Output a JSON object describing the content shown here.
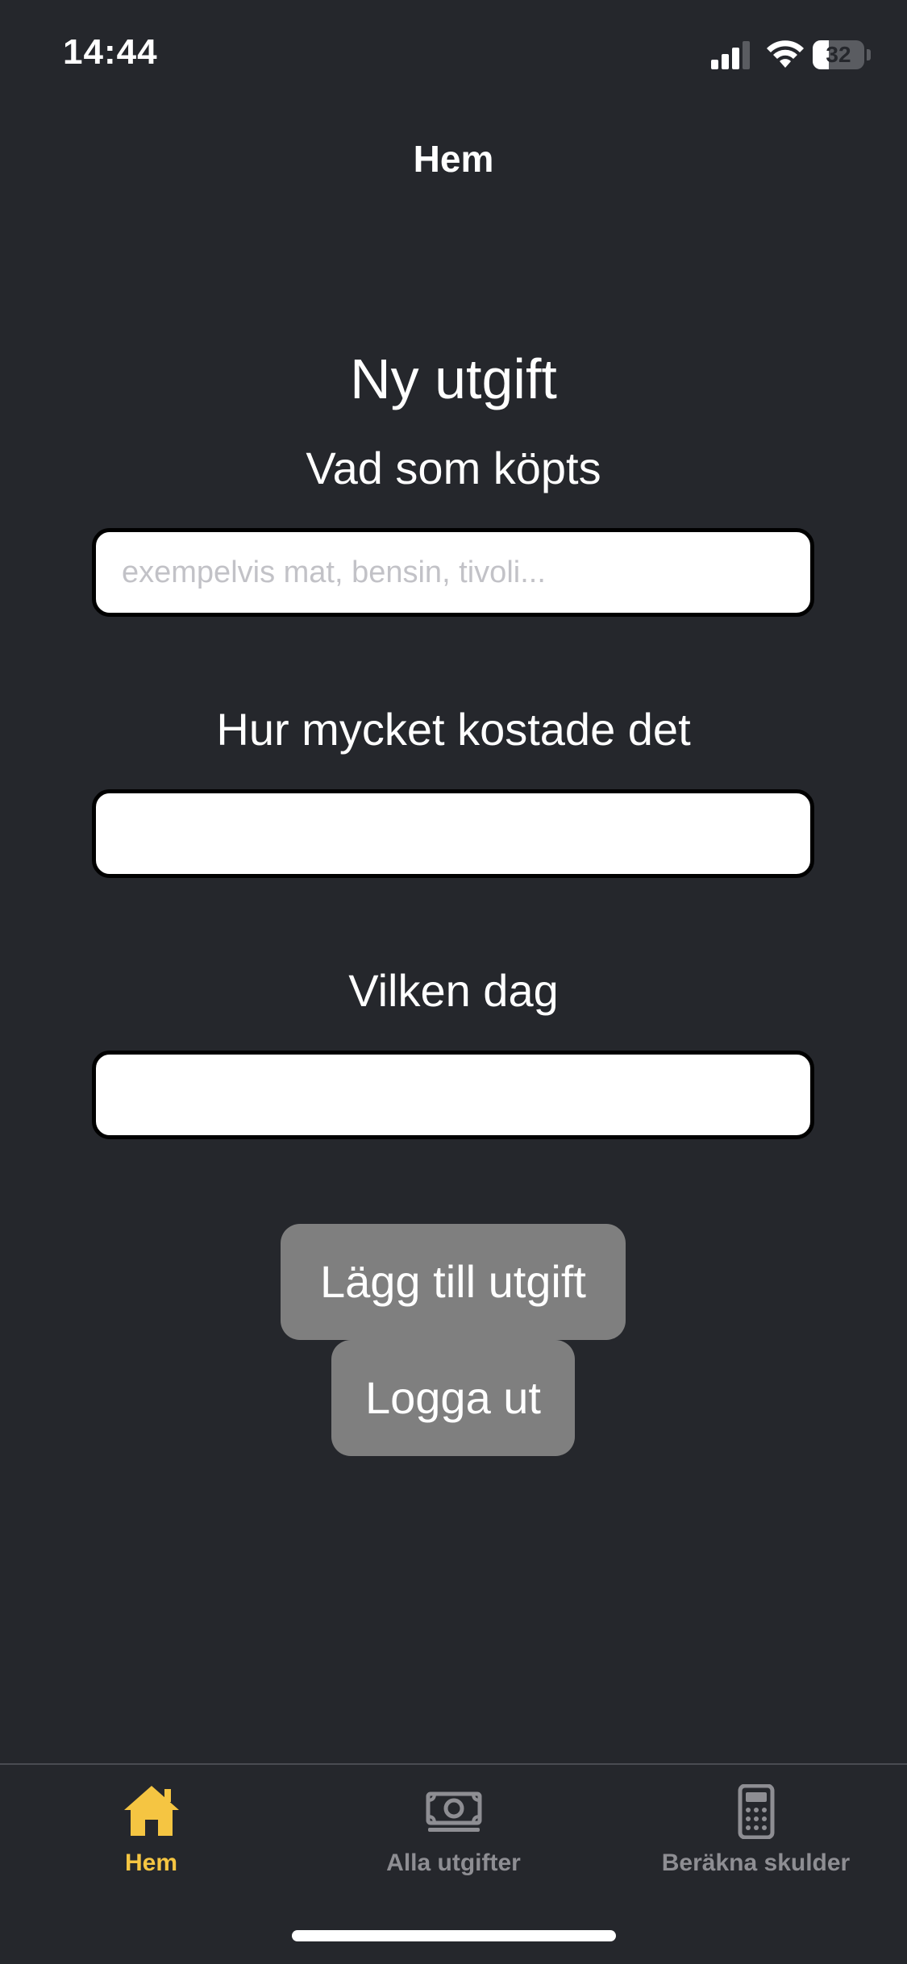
{
  "status_bar": {
    "time": "14:44",
    "battery_level": "32"
  },
  "nav": {
    "title": "Hem"
  },
  "form": {
    "heading": "Ny utgift",
    "what_label": "Vad som köpts",
    "what_placeholder": "exempelvis mat, bensin, tivoli...",
    "what_value": "",
    "cost_label": "Hur mycket kostade det",
    "cost_value": "",
    "day_label": "Vilken dag",
    "day_value": "",
    "add_button": "Lägg till utgift",
    "logout_button": "Logga ut"
  },
  "tabbar": {
    "tabs": [
      {
        "label": "Hem",
        "icon": "home-icon",
        "active": true
      },
      {
        "label": "Alla utgifter",
        "icon": "money-icon",
        "active": false
      },
      {
        "label": "Beräkna skulder",
        "icon": "calculator-icon",
        "active": false
      }
    ]
  },
  "colors": {
    "background": "#25272c",
    "active_tab": "#f5c542",
    "inactive_tab": "#8e8e93",
    "button": "#7f7f7f"
  }
}
